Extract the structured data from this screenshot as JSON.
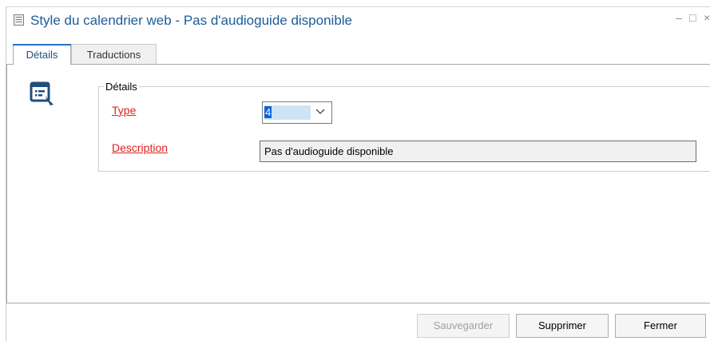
{
  "window": {
    "title": "Style du calendrier web - Pas d'audioguide disponible",
    "minimize": "–",
    "maximize": "□",
    "close": "×"
  },
  "tabs": [
    {
      "label": "Détails",
      "active": true
    },
    {
      "label": "Traductions",
      "active": false
    }
  ],
  "details": {
    "group_title": "Détails",
    "icon": "form-list-icon",
    "type": {
      "label": "Type",
      "value": "4"
    },
    "description": {
      "label": "Description",
      "value": "Pas d'audioguide disponible"
    }
  },
  "buttons": {
    "save": "Sauvegarder",
    "delete": "Supprimer",
    "close": "Fermer"
  },
  "colors": {
    "title_text": "#1d5c97",
    "required_label": "#e02020",
    "accent": "#2b72c5"
  }
}
